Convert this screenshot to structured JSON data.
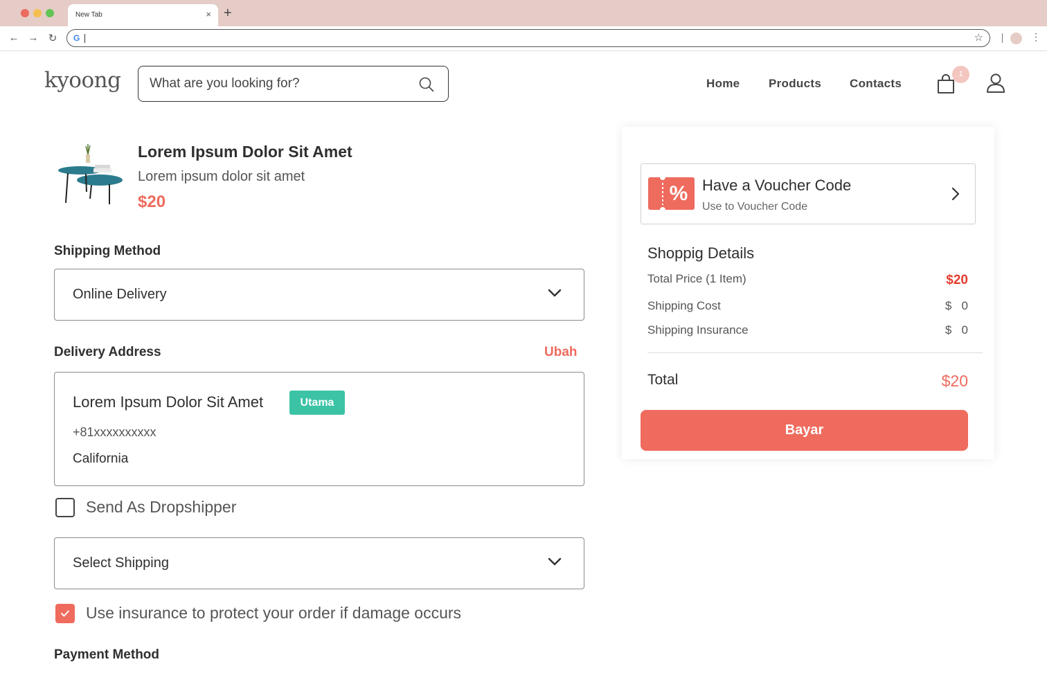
{
  "browser": {
    "tab_title": "New Tab",
    "tab_close": "×",
    "new_tab": "+",
    "back": "←",
    "forward": "→",
    "reload": "↻",
    "google_letter": "G",
    "star": "☆",
    "menu": "⋮"
  },
  "header": {
    "logo": "kyoong",
    "search_placeholder": "What are you looking for?",
    "nav": [
      "Home",
      "Products",
      "Contacts"
    ],
    "cart_count": "1"
  },
  "product": {
    "name": "Lorem Ipsum Dolor Sit Amet",
    "description": "Lorem ipsum dolor sit amet",
    "price": "$20"
  },
  "shipping_method": {
    "label": "Shipping Method",
    "selected": "Online Delivery"
  },
  "delivery_address": {
    "label": "Delivery Address",
    "edit_label": "Ubah",
    "name": "Lorem Ipsum Dolor Sit Amet",
    "badge": "Utama",
    "phone": "+81xxxxxxxxxx",
    "city": "California"
  },
  "dropshipper": {
    "label": "Send As Dropshipper",
    "checked": false
  },
  "shipping_select": {
    "placeholder": "Select Shipping"
  },
  "insurance": {
    "label": "Use insurance to protect your order if damage occurs",
    "checked": true
  },
  "payment_method": {
    "label": "Payment Method"
  },
  "summary": {
    "voucher_title": "Have a Voucher Code",
    "voucher_subtitle": "Use to Voucher Code",
    "voucher_icon_text": "%",
    "details_title": "Shoppig Details",
    "rows": [
      {
        "label": "Total Price (1 Item)",
        "value": "$20"
      },
      {
        "label": "Shipping Cost",
        "value": "$   0"
      },
      {
        "label": "Shipping Insurance",
        "value": "$   0"
      }
    ],
    "total_label": "Total",
    "total_value": "$20",
    "pay_button": "Bayar"
  },
  "colors": {
    "accent": "#ee6b5e",
    "badge": "#3cc3a6",
    "chrome": "#e6ccc6"
  }
}
